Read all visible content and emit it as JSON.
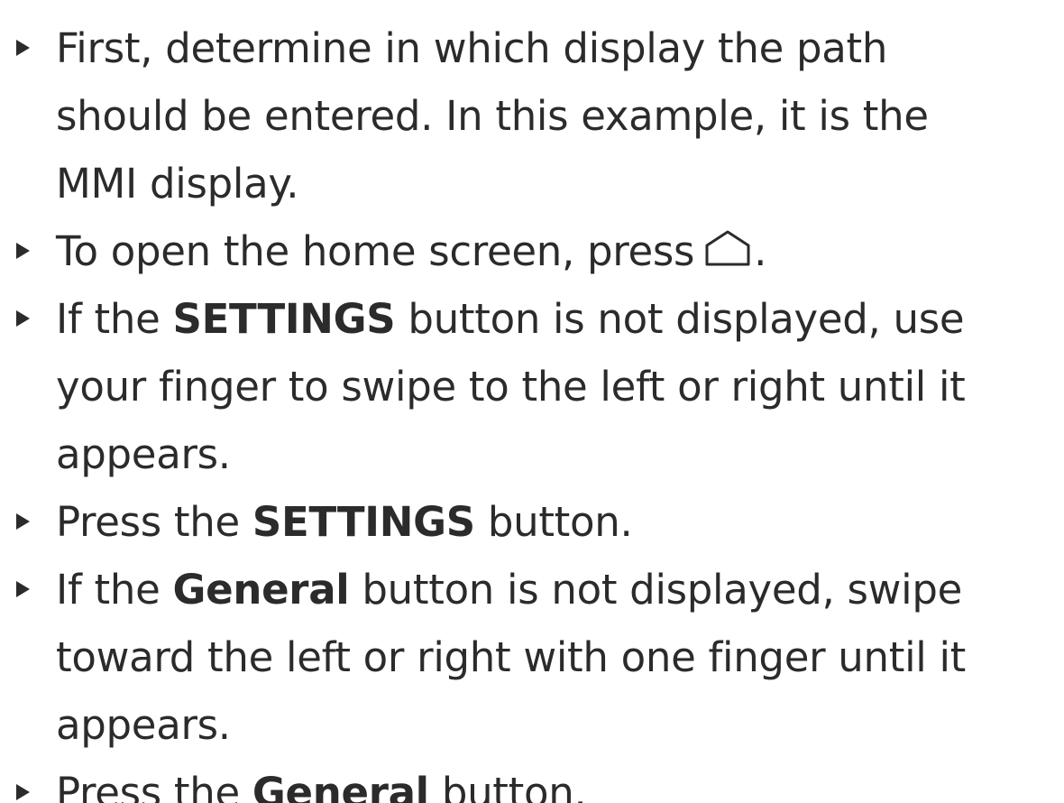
{
  "steps": [
    {
      "lines": [
        "First, determine in which display the path",
        "should be entered. In this example, it is the",
        "MMI display."
      ]
    },
    {
      "before": "To open the home screen, press",
      "icon": "home-icon",
      "after": "."
    },
    {
      "line1_before": "If the ",
      "line1_bold": "SETTINGS",
      "line1_after": " button is not displayed, use",
      "line2": "your finger to swipe to the left or right until it",
      "line3": "appears."
    },
    {
      "before": "Press the ",
      "bold": "SETTINGS",
      "after": " button."
    },
    {
      "line1_before": "If the ",
      "line1_bold": "General",
      "line1_after": " button is not displayed, swipe",
      "line2": "toward the left or right with one finger until it",
      "line3": "appears."
    },
    {
      "before": "Press the ",
      "bold": "General",
      "after": " button."
    }
  ],
  "text_color": "#2b2b2b",
  "background_color": "#ffffff"
}
